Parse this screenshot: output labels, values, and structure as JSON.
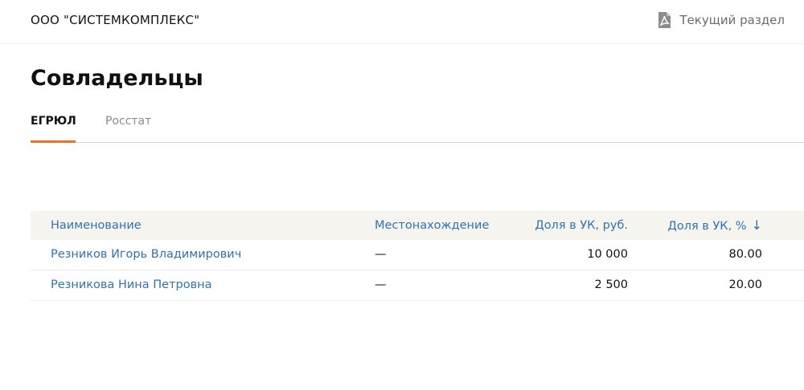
{
  "header": {
    "company_name": "ООО \"СИСТЕМКОМПЛЕКС\"",
    "section_link_label": "Текущий раздел",
    "section_link_icon": "pdf-icon"
  },
  "page": {
    "title": "Совладельцы"
  },
  "tabs": [
    {
      "label": "ЕГРЮЛ",
      "active": true
    },
    {
      "label": "Росстат",
      "active": false
    }
  ],
  "colors": {
    "accent": "#e8742a",
    "link": "#2f73b5",
    "header_bg": "#f5f4ef"
  },
  "table": {
    "columns": {
      "name": "Наименование",
      "location": "Местонахождение",
      "share_rub": "Доля в УК, руб.",
      "share_pct": "Доля в УК, %",
      "sort_indicator": "↓"
    },
    "rows": [
      {
        "name": "Резников Игорь Владимирович",
        "location": "—",
        "share_rub": "10 000",
        "share_pct": "80.00"
      },
      {
        "name": "Резникова Нина Петровна",
        "location": "—",
        "share_rub": "2 500",
        "share_pct": "20.00"
      }
    ]
  }
}
